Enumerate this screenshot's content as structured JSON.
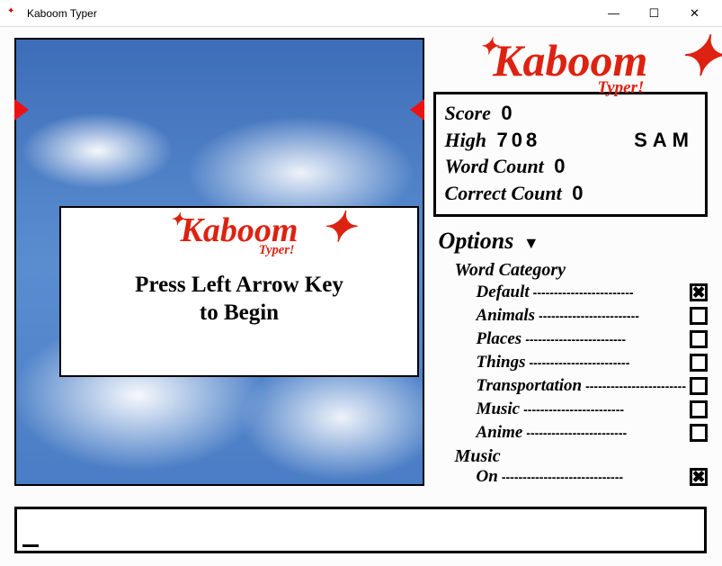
{
  "window": {
    "title": "Kaboom Typer"
  },
  "logo": {
    "main": "Kaboom",
    "sub": "Typer!"
  },
  "prompt": {
    "line1": "Press Left Arrow Key",
    "line2": "to Begin"
  },
  "stats": {
    "score_label": "Score",
    "score": "0",
    "high_label": "High",
    "high": "708",
    "high_name": "SAM",
    "word_label": "Word Count",
    "word": "0",
    "correct_label": "Correct Count",
    "correct": "0"
  },
  "options": {
    "header": "Options",
    "category_label": "Word Category",
    "categories": [
      {
        "label": "Default",
        "checked": true
      },
      {
        "label": "Animals",
        "checked": false
      },
      {
        "label": "Places",
        "checked": false
      },
      {
        "label": "Things",
        "checked": false
      },
      {
        "label": "Transportation",
        "checked": false
      },
      {
        "label": "Music",
        "checked": false
      },
      {
        "label": "Anime",
        "checked": false
      }
    ],
    "music_label": "Music",
    "music_on_label": "On",
    "music_on": true
  }
}
